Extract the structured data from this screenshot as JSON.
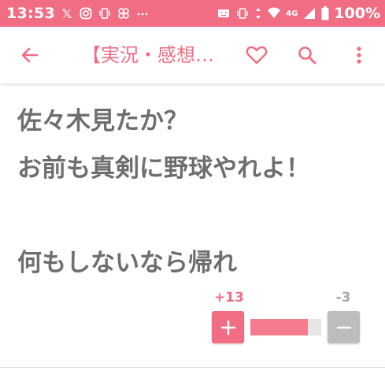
{
  "status_bar": {
    "time": "13:53",
    "x_label": "𝕏",
    "network": "4G",
    "battery": "100%",
    "icons": [
      "x-icon",
      "instagram-icon",
      "vibrate-icon",
      "pinwheel-icon",
      "more-notifications-icon",
      "notification-box-icon",
      "vibrate-icon",
      "data-arrows-icon",
      "wifi-icon",
      "signal-icon",
      "battery-icon"
    ]
  },
  "app_bar": {
    "title": "【実況・感想…",
    "icons": [
      "back-arrow-icon",
      "heart-icon",
      "search-icon",
      "more-vert-icon"
    ]
  },
  "comment": {
    "lines": [
      "佐々木見たか？",
      "お前も真剣に野球やれよ！",
      "",
      "何もしないなら帰れ"
    ]
  },
  "votes": {
    "up_count": "+13",
    "down_count": "-3",
    "up_ratio": 0.81
  },
  "colors": {
    "accent": "#f06d83",
    "text": "#6e6e6e",
    "minus_button": "#bdbdbd",
    "track": "#e6e6e6"
  }
}
